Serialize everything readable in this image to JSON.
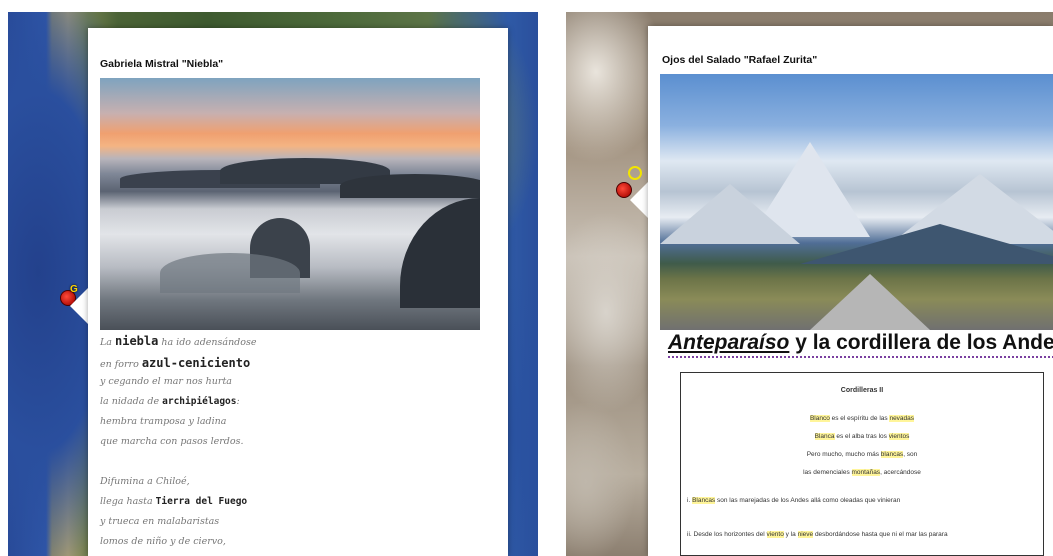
{
  "left_panel": {
    "marker_label": "G",
    "popup": {
      "title": "Gabriela Mistral \"Niebla\"",
      "close_label": "×",
      "poem": [
        {
          "pre": "La ",
          "key": "niebla",
          "post": " ha ido adensándose"
        },
        {
          "pre": "en forro ",
          "key": "azul-ceniciento",
          "post": ""
        },
        {
          "pre": "y cegando el mar nos hurta",
          "key": "",
          "post": ""
        },
        {
          "pre": "la nidada de ",
          "key": "archipiélagos",
          "post": ":"
        },
        {
          "pre": "hembra tramposa y ladina",
          "key": "",
          "post": ""
        },
        {
          "pre": "que marcha con pasos lerdos.",
          "key": "",
          "post": ""
        },
        {
          "pre": "Difumina a Chiloé,",
          "key": "",
          "post": ""
        },
        {
          "pre": "llega hasta ",
          "key": "Tierra del Fuego",
          "post": ""
        },
        {
          "pre": "y trueca en malabaristas",
          "key": "",
          "post": ""
        },
        {
          "pre": "lomos de niño y de ciervo,",
          "key": "",
          "post": ""
        }
      ]
    }
  },
  "right_panel": {
    "popup": {
      "title": "Ojos del Salado \"Rafael Zurita\"",
      "close_label": "×",
      "heading_strong": "Anteparaíso",
      "heading_rest": " y la cordillera de los Andes",
      "doc": {
        "title": "Cordilleras II",
        "lines": [
          {
            "parts": [
              {
                "t": "Blanco",
                "h": true
              },
              {
                "t": " es el espíritu de las ",
                "h": false
              },
              {
                "t": "nevadas",
                "h": true
              }
            ]
          },
          {
            "parts": [
              {
                "t": "Blanca",
                "h": true
              },
              {
                "t": " es el alba tras los ",
                "h": false
              },
              {
                "t": "vientos",
                "h": true
              }
            ]
          },
          {
            "parts": [
              {
                "t": "Pero mucho, mucho más ",
                "h": false
              },
              {
                "t": "blancas",
                "h": true
              },
              {
                "t": ", son",
                "h": false
              }
            ]
          },
          {
            "parts": [
              {
                "t": "las demenciales ",
                "h": false
              },
              {
                "t": "montañas",
                "h": true
              },
              {
                "t": ", acercándose",
                "h": false
              }
            ]
          }
        ],
        "item_i": {
          "parts": [
            {
              "t": "i. ",
              "h": false
            },
            {
              "t": "Blancas",
              "h": true
            },
            {
              "t": " son las marejadas de los Andes allá como oleadas que vinieran",
              "h": false
            }
          ]
        },
        "item_ii": {
          "parts": [
            {
              "t": "ii. Desde los horizontes del ",
              "h": false
            },
            {
              "t": "viento",
              "h": true
            },
            {
              "t": " y la ",
              "h": false
            },
            {
              "t": "nieve",
              "h": true
            },
            {
              "t": " desbordándose hasta que ni el mar las parara",
              "h": false
            }
          ]
        }
      }
    }
  },
  "colors": {
    "highlight": "#fff59a",
    "marker": "#c8180c",
    "dotted_underline": "#7a3fa0"
  }
}
